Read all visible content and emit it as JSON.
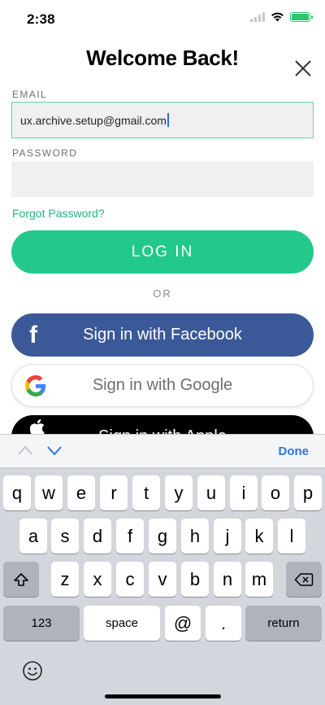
{
  "status_bar": {
    "time": "2:38"
  },
  "header": {
    "title": "Welcome Back!"
  },
  "form": {
    "email_label": "EMAIL",
    "email_value": "ux.archive.setup@gmail.com",
    "password_label": "PASSWORD",
    "password_value": "",
    "forgot_password": "Forgot Password?",
    "login_label": "LOG IN",
    "or_label": "OR"
  },
  "social": {
    "facebook_label": "Sign in with Facebook",
    "google_label": "Sign in with Google",
    "apple_label": "Sign in with Apple"
  },
  "keyboard": {
    "done_label": "Done",
    "row1": [
      "q",
      "w",
      "e",
      "r",
      "t",
      "y",
      "u",
      "i",
      "o",
      "p"
    ],
    "row2": [
      "a",
      "s",
      "d",
      "f",
      "g",
      "h",
      "j",
      "k",
      "l"
    ],
    "row3": [
      "z",
      "x",
      "c",
      "v",
      "b",
      "n",
      "m"
    ],
    "numbers_label": "123",
    "space_label": "space",
    "at_label": "@",
    "dot_label": ".",
    "return_label": "return"
  },
  "colors": {
    "accent_green": "#22c98a",
    "facebook_blue": "#3b5998",
    "link_green": "#23b383",
    "done_blue": "#2a79d6"
  },
  "icons": [
    "wifi-icon",
    "battery-icon",
    "close-icon",
    "facebook-icon",
    "google-icon",
    "apple-icon",
    "chevron-up-icon",
    "chevron-down-icon",
    "shift-icon",
    "backspace-icon",
    "emoji-icon"
  ]
}
